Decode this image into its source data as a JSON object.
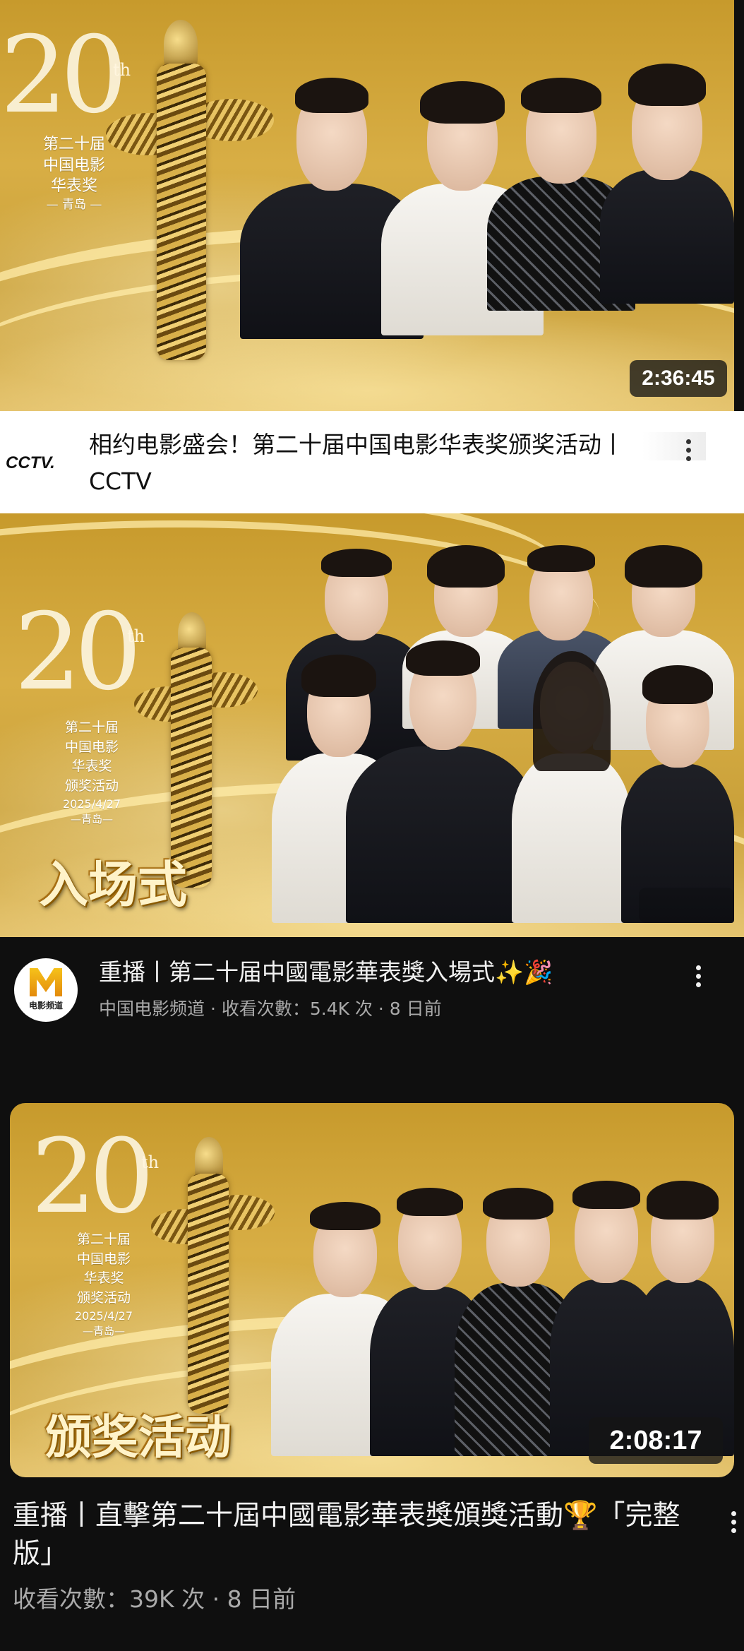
{
  "video1": {
    "thumb_20": "20",
    "thumb_th": "th",
    "thumb_lines": [
      "第二十届",
      "中国电影",
      "华表奖",
      "— 青岛 —"
    ],
    "duration": "2:36:45",
    "channel_logo": "CCTV.",
    "title": "相约电影盛会！第二十届中国电影华表奖颁奖活动丨CCTV"
  },
  "video2": {
    "thumb_20": "20",
    "thumb_th": "th",
    "thumb_lines": [
      "第二十届",
      "中国电影",
      "华表奖",
      "颁奖活动",
      "2025/4/27",
      "—青岛—"
    ],
    "banner": "入场式",
    "avatar_text": "电影频道",
    "title": "重播丨第二十届中國電影華表獎入場式✨🎉",
    "meta": "中国电影频道 · 收看次數：5.4K 次 · 8 日前"
  },
  "video3": {
    "thumb_20": "20",
    "thumb_th": "th",
    "thumb_lines": [
      "第二十届",
      "中国电影",
      "华表奖",
      "颁奖活动",
      "2025/4/27",
      "—青岛—"
    ],
    "banner": "颁奖活动",
    "duration": "2:08:17",
    "title": "重播丨直擊第二十屆中國電影華表獎頒獎活動🏆「完整版」",
    "meta": "收看次數：39K 次 · 8 日前"
  },
  "icons": {
    "more": "more-vert-icon"
  }
}
